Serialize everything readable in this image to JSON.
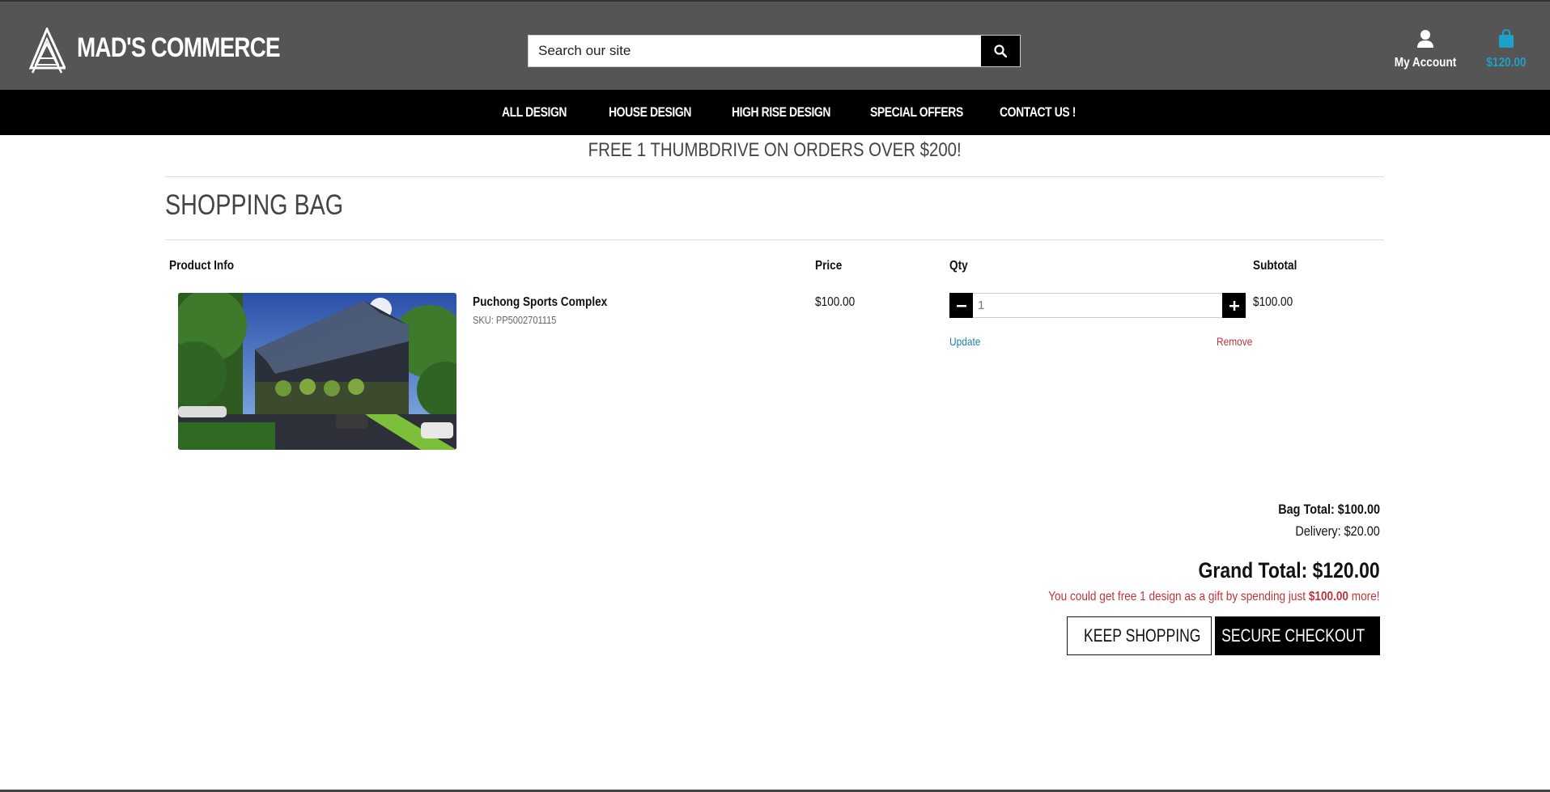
{
  "header": {
    "brand": "MAD'S COMMERCE",
    "search_placeholder": "Search our site",
    "account_label": "My Account",
    "cart_total": "$120.00"
  },
  "nav": {
    "items": [
      "ALL DESIGN",
      "HOUSE DESIGN",
      "HIGH RISE DESIGN",
      "SPECIAL OFFERS",
      "CONTACT US !"
    ]
  },
  "promo": "FREE 1 THUMBDRIVE ON ORDERS OVER $200!",
  "page_title": "SHOPPING BAG",
  "table": {
    "headers": [
      "Product Info",
      "Price",
      "Qty",
      "Subtotal"
    ],
    "items": [
      {
        "name": "Puchong Sports Complex",
        "sku": "SKU: PP5002701115",
        "price": "$100.00",
        "qty": "1",
        "subtotal": "$100.00",
        "update_label": "Update",
        "remove_label": "Remove"
      }
    ]
  },
  "summary": {
    "bag_total_label": "Bag Total:",
    "bag_total_value": "$100.00",
    "delivery": "Delivery: $20.00",
    "grand_total": "Grand Total: $120.00",
    "gift_prefix": "You could get free 1 design as a gift by spending just",
    "gift_amount": "$100.00",
    "gift_suffix": "more!"
  },
  "buttons": {
    "keep_shopping": "KEEP SHOPPING",
    "secure_checkout": "SECURE CHECKOUT"
  },
  "colors": {
    "header_bg": "#555555",
    "nav_bg": "#000000",
    "cart_accent": "#1ea0c9",
    "link_blue": "#1f7fa6",
    "alert_red": "#c0343a"
  },
  "icons": {
    "logo": "triangle-logo-icon",
    "search": "search-icon",
    "account": "user-icon",
    "cart": "shopping-bag-icon",
    "keep_shopping": "chevron-left-icon",
    "checkout": "lock-icon",
    "qty_minus": "minus-icon",
    "qty_plus": "plus-icon"
  }
}
